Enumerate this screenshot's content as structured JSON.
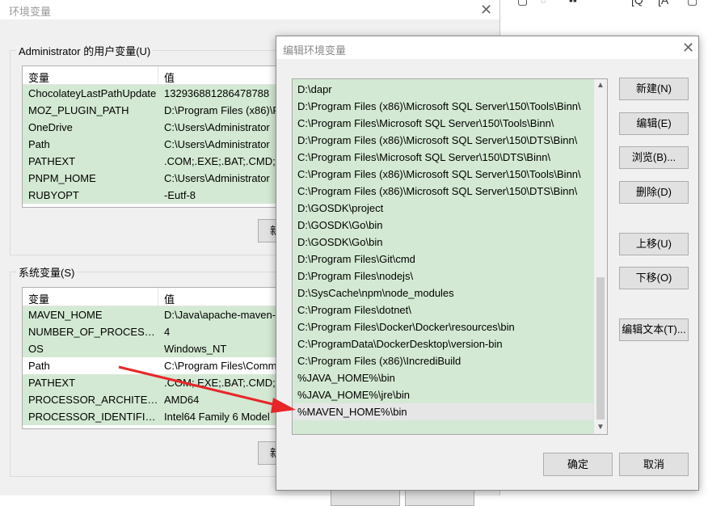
{
  "background": {
    "toolbar_icons": [
      "square-icon",
      "circle-icon",
      "dots-icon",
      "bracket-q-icon",
      "bracket-a-icon",
      "square2-icon"
    ]
  },
  "back_dialog": {
    "title": "环境变量",
    "close_glyph": "✕",
    "user_vars": {
      "label": "Administrator 的用户变量(U)",
      "col_var": "变量",
      "col_val": "值",
      "rows": [
        {
          "name": "ChocolateyLastPathUpdate",
          "value": "132936881286478788"
        },
        {
          "name": "MOZ_PLUGIN_PATH",
          "value": "D:\\Program Files (x86)\\F"
        },
        {
          "name": "OneDrive",
          "value": "C:\\Users\\Administrator"
        },
        {
          "name": "Path",
          "value": "C:\\Users\\Administrator"
        },
        {
          "name": "PATHEXT",
          "value": ".COM;.EXE;.BAT;.CMD;.V"
        },
        {
          "name": "PNPM_HOME",
          "value": "C:\\Users\\Administrator"
        },
        {
          "name": "RUBYOPT",
          "value": "-Eutf-8"
        }
      ],
      "new_button": "新"
    },
    "sys_vars": {
      "label": "系统变量(S)",
      "col_var": "变量",
      "col_val": "值",
      "rows": [
        {
          "name": "MAVEN_HOME",
          "value": "D:\\Java\\apache-maven-"
        },
        {
          "name": "NUMBER_OF_PROCESSORS",
          "value": "4"
        },
        {
          "name": "OS",
          "value": "Windows_NT"
        },
        {
          "name": "Path",
          "value": "C:\\Program Files\\Comm"
        },
        {
          "name": "PATHEXT",
          "value": ".COM;.EXE;.BAT;.CMD;.V"
        },
        {
          "name": "PROCESSOR_ARCHITECT...",
          "value": "AMD64"
        },
        {
          "name": "PROCESSOR_IDENTIFIER",
          "value": "Intel64 Family 6 Model"
        }
      ],
      "new_button": "新"
    }
  },
  "edit_dialog": {
    "title": "编辑环境变量",
    "close_glyph": "✕",
    "paths": [
      "D:\\dapr",
      "D:\\Program Files (x86)\\Microsoft SQL Server\\150\\Tools\\Binn\\",
      "C:\\Program Files\\Microsoft SQL Server\\150\\Tools\\Binn\\",
      "D:\\Program Files (x86)\\Microsoft SQL Server\\150\\DTS\\Binn\\",
      "C:\\Program Files\\Microsoft SQL Server\\150\\DTS\\Binn\\",
      "C:\\Program Files (x86)\\Microsoft SQL Server\\150\\Tools\\Binn\\",
      "C:\\Program Files (x86)\\Microsoft SQL Server\\150\\DTS\\Binn\\",
      "D:\\GOSDK\\project",
      "D:\\GOSDK\\Go\\bin",
      "D:\\GOSDK\\Go\\bin",
      "D:\\Program Files\\Git\\cmd",
      "D:\\Program Files\\nodejs\\",
      "D:\\SysCache\\npm\\node_modules",
      "C:\\Program Files\\dotnet\\",
      "C:\\Program Files\\Docker\\Docker\\resources\\bin",
      "C:\\ProgramData\\DockerDesktop\\version-bin",
      "C:\\Program Files (x86)\\IncrediBuild",
      "%JAVA_HOME%\\bin",
      "%JAVA_HOME%\\jre\\bin",
      "%MAVEN_HOME%\\bin"
    ],
    "selected_index": 19,
    "buttons": {
      "new": "新建(N)",
      "edit": "编辑(E)",
      "browse": "浏览(B)...",
      "delete": "删除(D)",
      "move_up": "上移(U)",
      "move_down": "下移(O)",
      "edit_text": "编辑文本(T)...",
      "ok": "确定",
      "cancel": "取消"
    },
    "scroll_up_glyph": "▲",
    "scroll_down_glyph": "▼"
  },
  "annotation": {
    "arrow_color": "#e8262a"
  }
}
